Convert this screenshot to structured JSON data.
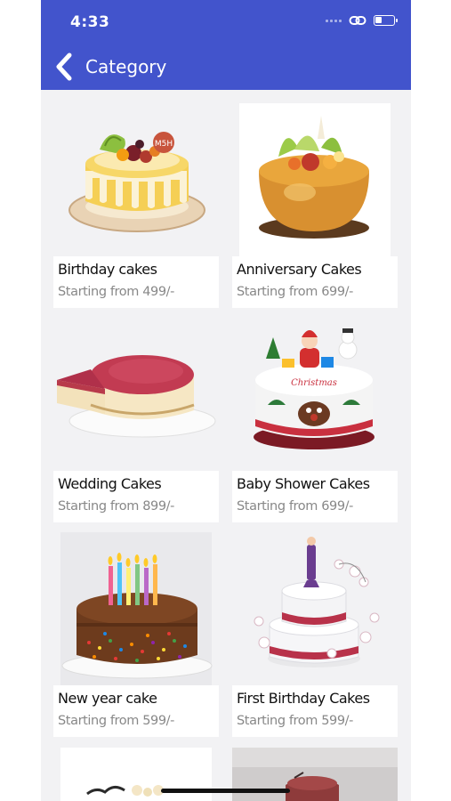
{
  "status_bar": {
    "time": "4:33"
  },
  "header": {
    "title": "Category"
  },
  "colors": {
    "header_bg": "#4254cc",
    "page_bg": "#f2f2f4"
  },
  "categories": [
    {
      "name": "Birthday cakes",
      "price": "Starting from 499/-"
    },
    {
      "name": "Anniversary Cakes",
      "price": "Starting from 699/-"
    },
    {
      "name": "Wedding Cakes",
      "price": "Starting from 899/-"
    },
    {
      "name": "Baby Shower Cakes",
      "price": "Starting from 699/-"
    },
    {
      "name": "New year cake",
      "price": "Starting from 599/-"
    },
    {
      "name": "First Birthday Cakes",
      "price": "Starting from 599/-"
    }
  ]
}
